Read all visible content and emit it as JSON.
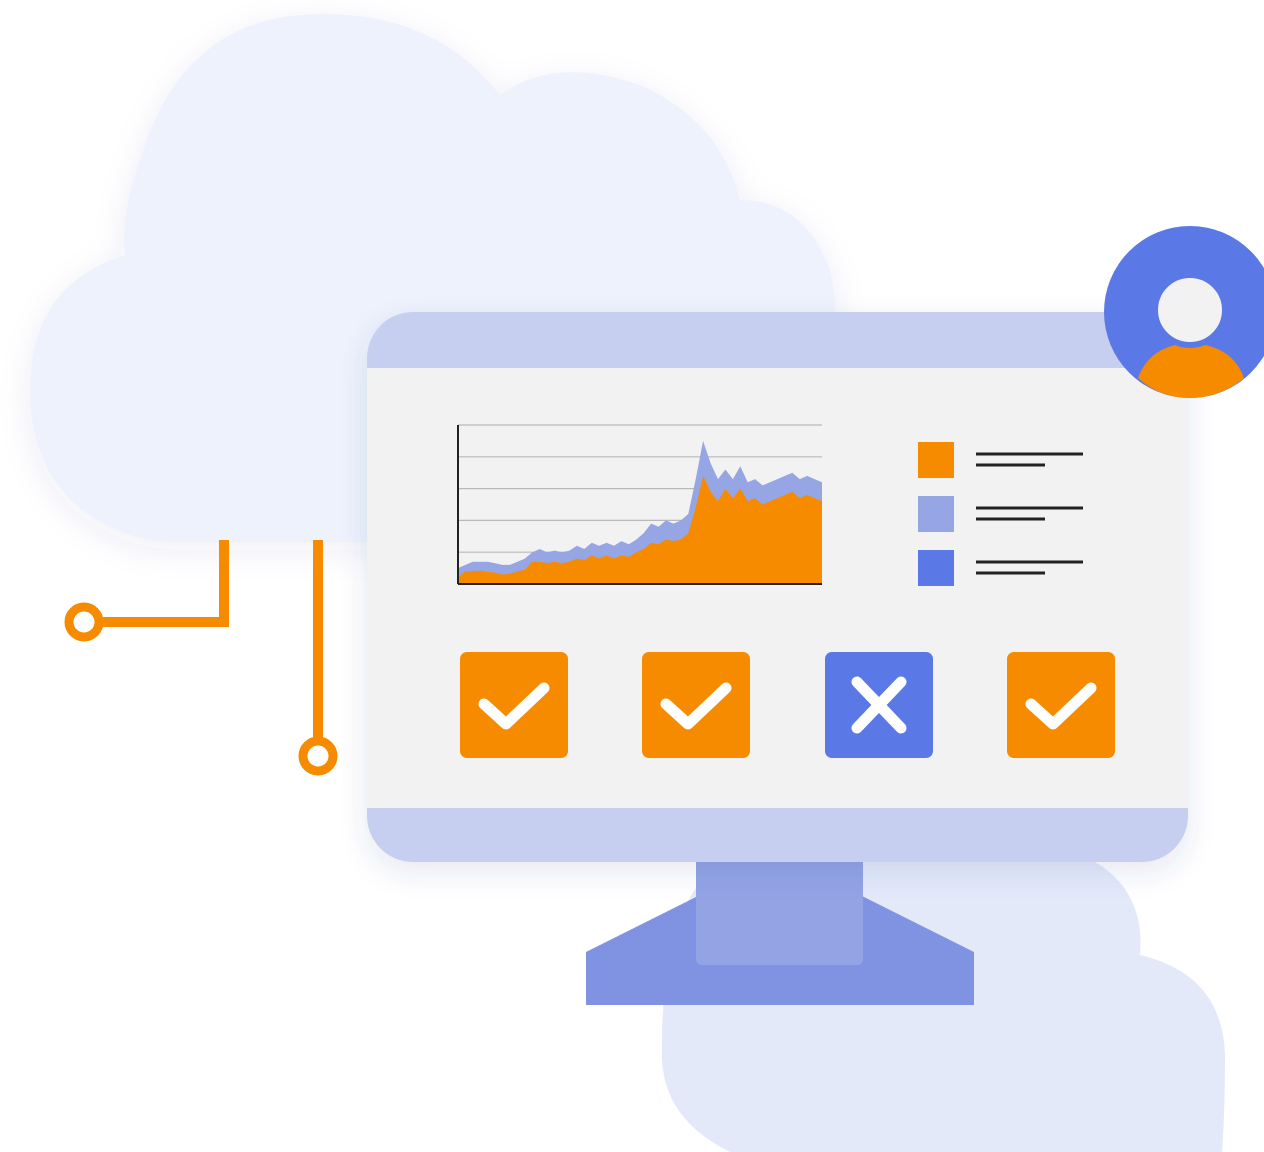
{
  "colors": {
    "background": "#ffffff",
    "cloud": "#eef2fc",
    "cloud_lower": "#e4e9fa",
    "monitor_bezel": "#c7cff1",
    "monitor_screen": "#f2f2f2",
    "stand_neck": "#93a3e4",
    "stand_base": "#7f93e2",
    "accent_orange": "#f68b00",
    "accent_blue": "#5b79e6",
    "accent_lightblue": "#96a6e4",
    "line_dark": "#222222",
    "gridline": "#b9b9b9",
    "avatar_face": "#f2f2f2"
  },
  "icons": {
    "avatar": "user-avatar-icon",
    "check": "checkmark-icon",
    "cross": "x-mark-icon",
    "circuit_node": "circuit-node-icon"
  },
  "status_tiles": [
    {
      "state": "check",
      "color": "#f68b00"
    },
    {
      "state": "check",
      "color": "#f68b00"
    },
    {
      "state": "cross",
      "color": "#5b79e6"
    },
    {
      "state": "check",
      "color": "#f68b00"
    }
  ],
  "legend": [
    {
      "color": "#f68b00"
    },
    {
      "color": "#96a6e4"
    },
    {
      "color": "#5b79e6"
    }
  ],
  "chart_data": {
    "type": "area",
    "x": [
      0,
      1,
      2,
      3,
      4,
      5,
      6,
      7,
      8,
      9,
      10,
      11,
      12,
      13,
      14,
      15,
      16,
      17,
      18,
      19,
      20,
      21,
      22,
      23,
      24,
      25,
      26,
      27,
      28,
      29,
      30,
      31,
      32,
      33,
      34,
      35,
      36,
      37,
      38,
      39,
      40,
      41,
      42,
      43,
      44,
      45,
      46,
      47,
      48,
      49
    ],
    "series": [
      {
        "values": [
          2,
          4,
          4,
          4.2,
          3.8,
          3.6,
          3,
          3.2,
          4,
          4.5,
          7,
          7,
          6.5,
          7,
          6.5,
          7,
          8,
          7.5,
          9,
          8,
          9,
          8,
          9,
          8.5,
          10,
          11,
          13,
          12.5,
          14,
          13.5,
          14,
          16,
          24,
          34,
          29,
          26,
          30,
          27,
          30,
          26,
          27,
          25,
          26,
          27,
          28,
          29,
          27,
          28,
          27,
          26
        ]
      },
      {
        "values": [
          5,
          6,
          7,
          7,
          7,
          6.5,
          6,
          6,
          7,
          8,
          10,
          11,
          10,
          10.5,
          10,
          10.5,
          12,
          11,
          13,
          12,
          13,
          12,
          13.5,
          12.5,
          14,
          16,
          19,
          18,
          20,
          19,
          20,
          22,
          33,
          45,
          38,
          33,
          36,
          33,
          37,
          32,
          33,
          31,
          32,
          33,
          34,
          35,
          33,
          34,
          33,
          32
        ]
      }
    ],
    "ylim": [
      0,
      50
    ],
    "grid": true,
    "legend_placement": "right"
  }
}
